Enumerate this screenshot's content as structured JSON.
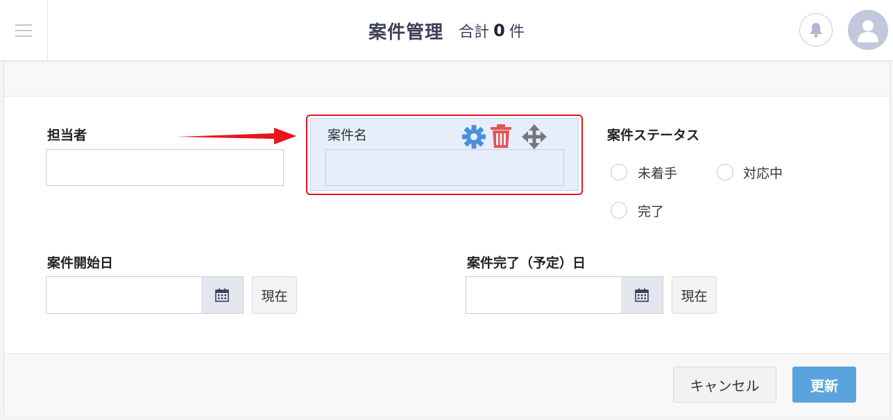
{
  "header": {
    "title": "案件管理",
    "total_prefix": "合計",
    "total_count": "0",
    "total_suffix": "件"
  },
  "form": {
    "assignee": {
      "label": "担当者",
      "value": ""
    },
    "case_name": {
      "label": "案件名",
      "value": ""
    },
    "status": {
      "label": "案件ステータス",
      "options": [
        "未着手",
        "対応中",
        "完了"
      ]
    },
    "start_date": {
      "label": "案件開始日",
      "value": "",
      "now_label": "現在"
    },
    "end_date": {
      "label": "案件完了（予定）日",
      "value": "",
      "now_label": "現在"
    }
  },
  "footer": {
    "cancel_label": "キャンセル",
    "update_label": "更新"
  },
  "colors": {
    "accent": "#5ba3dc",
    "highlight": "#e8141c",
    "gear": "#4a90d9",
    "trash": "#e05555",
    "move": "#777777",
    "arrow": "#e8141c"
  },
  "icons": [
    "menu-icon",
    "bell-icon",
    "user-icon",
    "gear-icon",
    "trash-icon",
    "move-icon",
    "calendar-icon",
    "arrow-icon"
  ]
}
